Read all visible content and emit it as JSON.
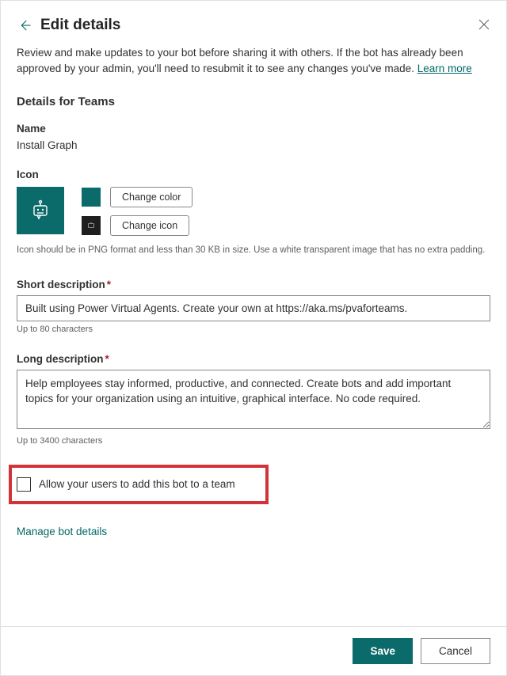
{
  "header": {
    "title": "Edit details"
  },
  "intro": {
    "text": "Review and make updates to your bot before sharing it with others. If the bot has already been approved by your admin, you'll need to resubmit it to see any changes you've made. ",
    "learn_more": "Learn more"
  },
  "section_heading": "Details for Teams",
  "name": {
    "label": "Name",
    "value": "Install Graph"
  },
  "icon": {
    "label": "Icon",
    "change_color": "Change color",
    "change_icon": "Change icon",
    "hint": "Icon should be in PNG format and less than 30 KB in size. Use a white transparent image that has no extra padding."
  },
  "short_desc": {
    "label": "Short description",
    "value": "Built using Power Virtual Agents. Create your own at https://aka.ms/pvaforteams.",
    "hint": "Up to 80 characters"
  },
  "long_desc": {
    "label": "Long description",
    "value": "Help employees stay informed, productive, and connected. Create bots and add important topics for your organization using an intuitive, graphical interface. No code required.",
    "hint": "Up to 3400 characters"
  },
  "allow_team": {
    "label": "Allow your users to add this bot to a team"
  },
  "manage_link": "Manage bot details",
  "footer": {
    "save": "Save",
    "cancel": "Cancel"
  }
}
